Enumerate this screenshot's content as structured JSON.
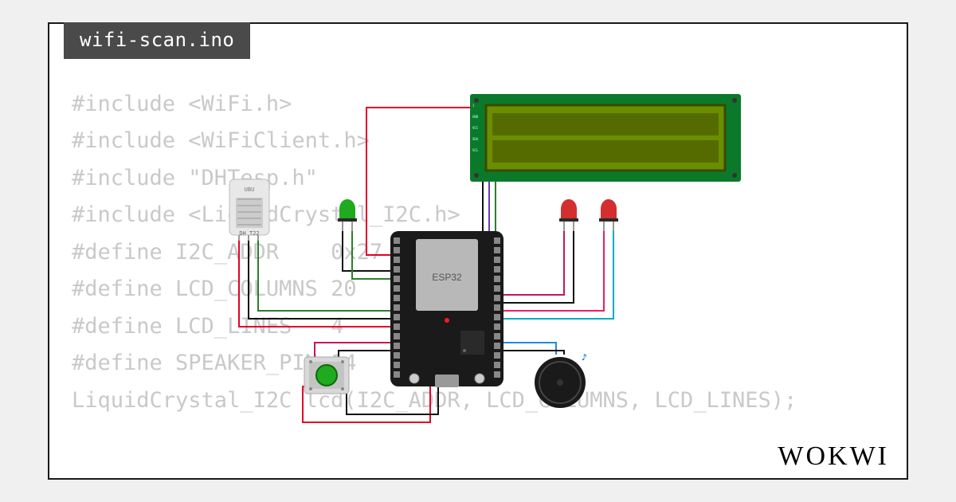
{
  "tab_title": "wifi-scan.ino",
  "brand": "WOKWI",
  "code_lines": [
    "#include <WiFi.h>",
    "#include <WiFiClient.h>",
    "#include \"DHTesp.h\"",
    "#include <LiquidCrystal_I2C.h>",
    "#define I2C_ADDR    0x27",
    "#define LCD_COLUMNS 20",
    "#define LCD_LINES   4",
    "#define SPEAKER_PIN 14",
    "LiquidCrystal_I2C lcd(I2C_ADDR, LCD_COLUMNS, LCD_LINES);"
  ],
  "components": {
    "esp32_label": "ESP32",
    "dht_label": "DH T22",
    "lcd_pins": [
      "1",
      "GND",
      "VCC",
      "SDA",
      "SCL"
    ]
  },
  "wire_colors": {
    "power": "#e4002b",
    "ground": "#111111",
    "sda": "#6a3ab2",
    "scl": "#2e7d32",
    "signal1": "#c2185b",
    "signal2": "#1e88e5",
    "signal3": "#e91e63",
    "signal4": "#00acc1",
    "signal5": "#8e24aa"
  }
}
